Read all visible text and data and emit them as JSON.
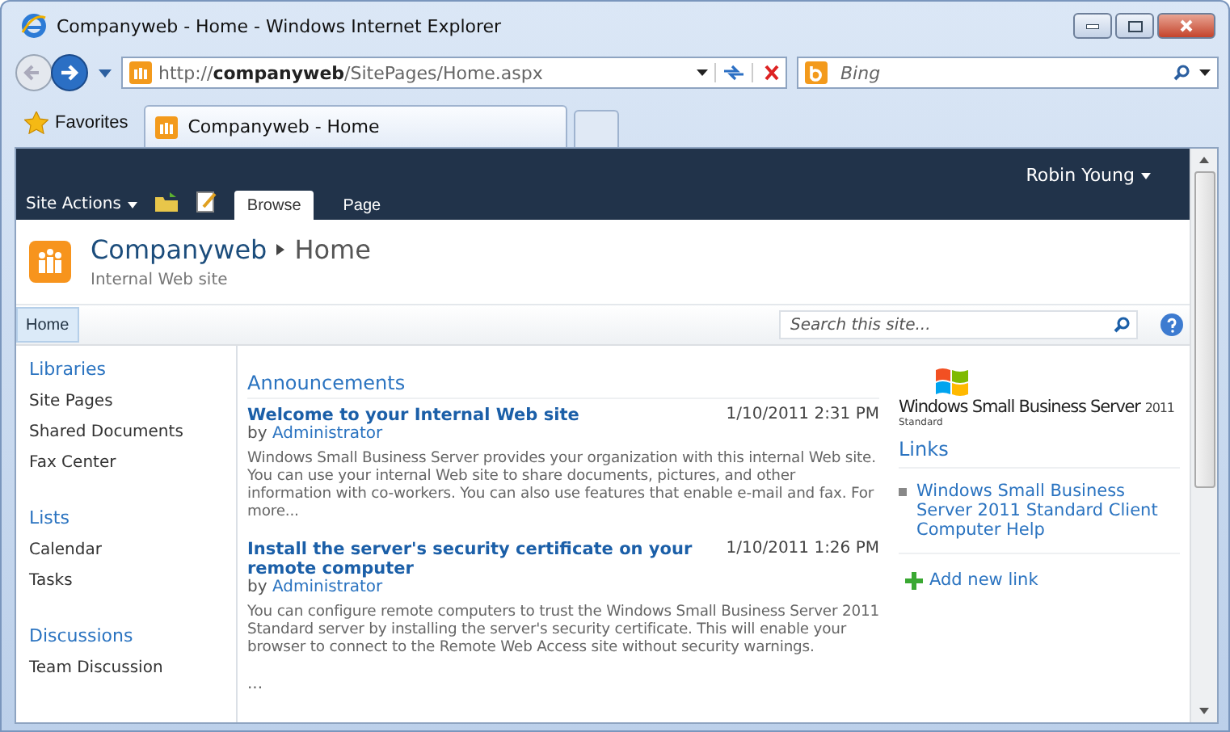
{
  "window": {
    "title": "Companyweb - Home - Windows Internet Explorer"
  },
  "address_bar": {
    "url": "http://**companyweb**/SitePages/Home.aspx"
  },
  "search_box": {
    "placeholder": "Bing"
  },
  "favorites": {
    "label": "Favorites"
  },
  "tabs": [
    {
      "label": "Companyweb - Home",
      "selected": true
    }
  ],
  "ribbon": {
    "site_actions": "Site Actions",
    "user": "Robin Young",
    "tabs": [
      {
        "label": "Browse",
        "selected": true
      },
      {
        "label": "Page",
        "selected": false
      }
    ]
  },
  "site": {
    "title": "Companyweb",
    "page": "Home",
    "description": "Internal Web site"
  },
  "top_nav": [
    {
      "label": "Home",
      "selected": true
    }
  ],
  "site_search": {
    "placeholder": "Search this site..."
  },
  "quick_launch": [
    {
      "heading": "Libraries",
      "items": [
        "Site Pages",
        "Shared Documents",
        "Fax Center"
      ]
    },
    {
      "heading": "Lists",
      "items": [
        "Calendar",
        "Tasks"
      ]
    },
    {
      "heading": "Discussions",
      "items": [
        "Team Discussion"
      ]
    }
  ],
  "announcements": {
    "title": "Announcements",
    "more": "...",
    "items": [
      {
        "title": "Welcome to your Internal Web site",
        "date": "1/10/2011 2:31 PM",
        "by": "by",
        "author": "Administrator",
        "body": "Windows Small Business Server provides your organization with this internal Web site. You can use your internal Web site to share documents, pictures, and other information with co-workers. You can also use features that enable e-mail and fax. For more..."
      },
      {
        "title": "Install the server's security certificate on your remote computer",
        "date": "1/10/2011 1:26 PM",
        "by": "by",
        "author": "Administrator",
        "body": "You can configure remote computers to trust the Windows Small Business Server 2011 Standard server by installing the server's security certificate. This will enable your browser to connect to the Remote Web Access site without security warnings."
      }
    ]
  },
  "logo": {
    "name": "Windows Small Business Server",
    "version": "2011",
    "edition": "Standard"
  },
  "links": {
    "title": "Links",
    "items": [
      "Windows Small Business Server 2011 Standard Client Computer Help"
    ],
    "add": "Add new link"
  }
}
